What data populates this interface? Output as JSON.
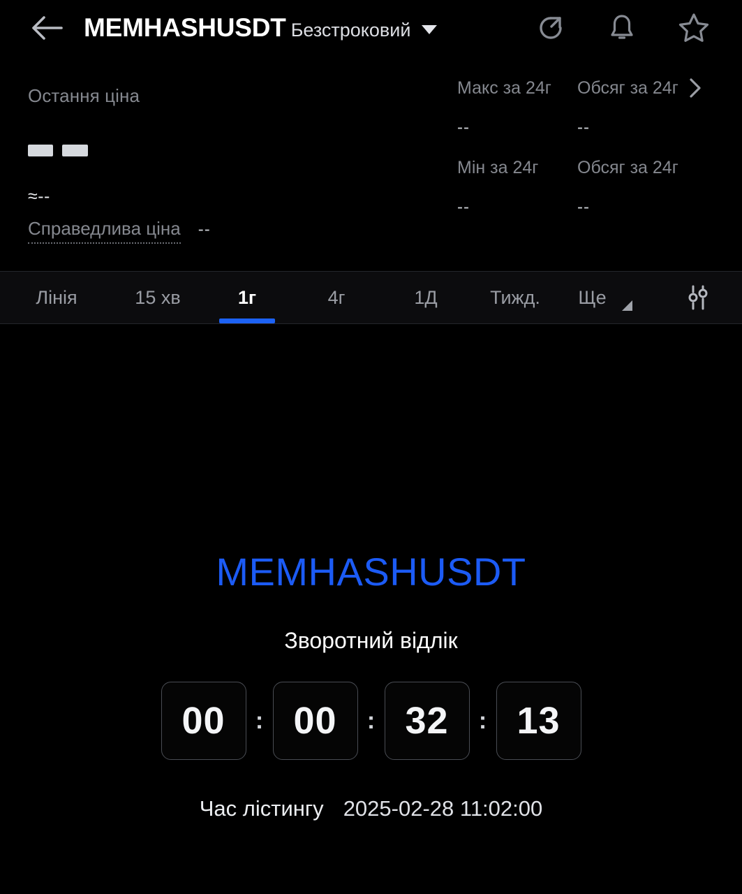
{
  "header": {
    "back_icon": "arrow-left-icon",
    "pair": "MEMHASHUSDT",
    "contract_type": "Безстроковий",
    "dropdown_icon": "caret-down-icon",
    "actions": [
      {
        "name": "share-icon",
        "label": "share"
      },
      {
        "name": "bell-icon",
        "label": "alerts"
      },
      {
        "name": "star-icon",
        "label": "favorite"
      }
    ]
  },
  "stats": {
    "last_price_label": "Остання ціна",
    "last_price_value": "",
    "approx_value": "≈--",
    "fair_price_label": "Справедлива ціна",
    "fair_price_value": "--",
    "right": [
      {
        "label": "Макс за 24г",
        "value": "--"
      },
      {
        "label": "Обсяг за 24г",
        "value": "--"
      },
      {
        "label": "Мін за 24г",
        "value": "--"
      },
      {
        "label": "Обсяг за 24г",
        "value": "--"
      }
    ],
    "expand_icon": "chevron-right-icon"
  },
  "tabs": {
    "items": [
      {
        "label": "Лінія",
        "active": false
      },
      {
        "label": "15 хв",
        "active": false
      },
      {
        "label": "1г",
        "active": true
      },
      {
        "label": "4г",
        "active": false
      },
      {
        "label": "1Д",
        "active": false
      },
      {
        "label": "Тижд.",
        "active": false
      },
      {
        "label": "Ще",
        "active": false
      }
    ],
    "settings_icon": "sliders-icon",
    "active_color": "#1c62f5"
  },
  "countdown": {
    "symbol": "MEMHASHUSDT",
    "symbol_color": "#1c5bf5",
    "caption": "Зворотний відлік",
    "separator": ":",
    "segments": [
      {
        "unit": "days",
        "value": "00"
      },
      {
        "unit": "hours",
        "value": "00"
      },
      {
        "unit": "minutes",
        "value": "32"
      },
      {
        "unit": "seconds",
        "value": "13"
      }
    ],
    "listing_label": "Час лістингу",
    "listing_time": "2025-02-28 11:02:00"
  }
}
